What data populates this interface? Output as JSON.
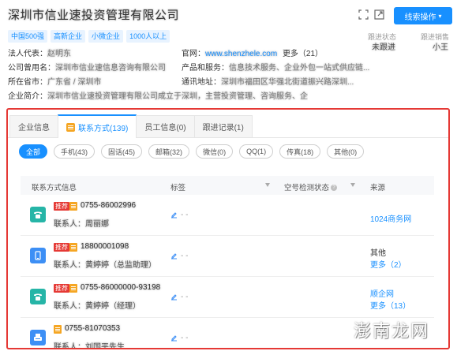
{
  "header": {
    "company_name": "深圳市信业速投资管理有限公司",
    "clue_button": "线索操作",
    "tags": [
      "中国500强",
      "高新企业",
      "小微企业",
      "1000人以上"
    ],
    "follow_status_label": "跟进状态",
    "follow_status_value": "未跟进",
    "follow_sales_label": "跟进销售",
    "follow_sales_value": "小王"
  },
  "info": {
    "legal_rep_label": "法人代表：",
    "legal_rep_value": "赵明东",
    "website_label": "官网：",
    "website_value": "www.shenzhele.com",
    "website_more": "更多（21）",
    "former_name_label": "公司曾用名：",
    "former_name_value": "深圳市信业速信息咨询有限公司",
    "products_label": "产品和服务：",
    "products_value": "信息技术服务、企业外包一站式供应链...",
    "city_label": "所在省市：",
    "city_value": "广东省 / 深圳市",
    "address_label": "通讯地址：",
    "address_value": "深圳市福田区华强北街道振兴路深圳...",
    "intro_label": "企业简介：",
    "intro_value": "深圳市信业速投资管理有限公司成立于深圳，主营投资管理、咨询服务、企业管理等多个领域，致力于成为一家上..."
  },
  "tabs": [
    {
      "label": "企业信息",
      "active": false
    },
    {
      "label": "联系方式(139)",
      "active": true
    },
    {
      "label": "员工信息(0)",
      "active": false
    },
    {
      "label": "跟进记录(1)",
      "active": false
    }
  ],
  "filters": [
    {
      "label": "全部",
      "active": true
    },
    {
      "label": "手机(43)",
      "active": false
    },
    {
      "label": "固话(45)",
      "active": false
    },
    {
      "label": "邮箱(32)",
      "active": false
    },
    {
      "label": "微信(0)",
      "active": false
    },
    {
      "label": "QQ(1)",
      "active": false
    },
    {
      "label": "传真(18)",
      "active": false
    },
    {
      "label": "其他(0)",
      "active": false
    }
  ],
  "table": {
    "columns": [
      "联系方式信息",
      "标签",
      "空号检测状态",
      "来源"
    ],
    "rows": [
      {
        "icon": "landline-icon",
        "icon_color": "#26b5a7",
        "recommended": "推荐",
        "number": "0755-86002996",
        "contact": "联系人：周丽娜",
        "tag": "- -",
        "source_line1": "1024商务网",
        "source_line2": ""
      },
      {
        "icon": "mobile-icon",
        "icon_color": "#3d8ff5",
        "recommended": "推荐",
        "number": "18800001098",
        "contact": "联系人：黄婷婷（总监助理）",
        "tag": "- -",
        "source_line1": "其他",
        "source_line2": "更多（2）"
      },
      {
        "icon": "landline-icon",
        "icon_color": "#26b5a7",
        "recommended": "推荐",
        "number": "0755-86000000-93198",
        "contact": "联系人：黄婷婷（经理）",
        "tag": "- -",
        "source_line1": "顺企网",
        "source_line2": "更多（13）"
      },
      {
        "icon": "fax-icon",
        "icon_color": "#3d8ff5",
        "recommended": "",
        "number": "0755-81070353",
        "contact": "联系人：刘国平先生",
        "tag": "- -",
        "source_line1": "",
        "source_line2": ""
      }
    ]
  },
  "watermark": "澎南龙网"
}
